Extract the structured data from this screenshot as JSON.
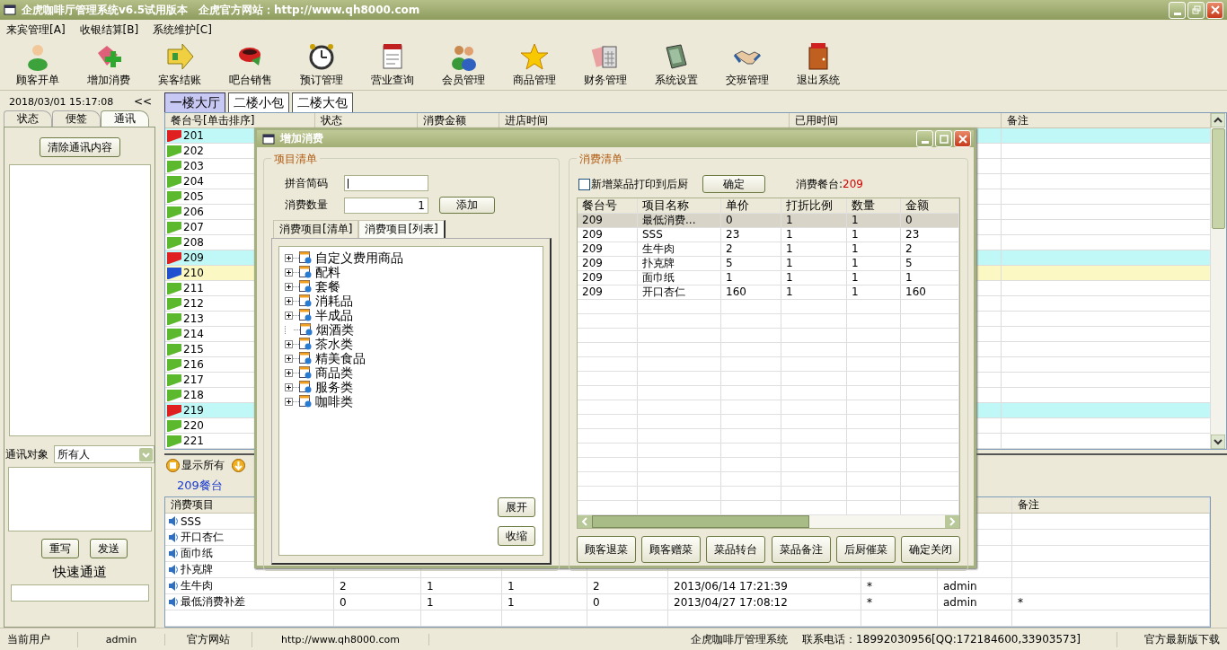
{
  "window": {
    "title": "企虎咖啡厅管理系统v6.5试用版本　企虎官方网站：http://www.qh8000.com"
  },
  "menu": [
    "来宾管理[A]",
    "收银结算[B]",
    "系统维护[C]"
  ],
  "toolbar": [
    "顾客开单",
    "增加消费",
    "宾客结账",
    "吧台销售",
    "预订管理",
    "营业查询",
    "会员管理",
    "商品管理",
    "财务管理",
    "系统设置",
    "交班管理",
    "退出系统"
  ],
  "left_panel": {
    "datetime": "2018/03/01 15:17:08",
    "collapse": "<<",
    "tabs": [
      {
        "label": "状态",
        "selected": false
      },
      {
        "label": "便签",
        "selected": false
      },
      {
        "label": "通讯",
        "selected": true
      }
    ],
    "clear_button": "清除通讯内容",
    "recipient_label": "通讯对象",
    "recipient": "所有人",
    "rewrite_button": "重写",
    "send_button": "发送",
    "quick_channel": "快速通道"
  },
  "floor_tabs": [
    {
      "label": "一楼大厅",
      "selected": true
    },
    {
      "label": "二楼小包",
      "selected": false
    },
    {
      "label": "二楼大包",
      "selected": false
    }
  ],
  "tables": {
    "columns": [
      "餐台号[单击排序]",
      "状态",
      "消费金额",
      "进店时间",
      "已用时间",
      "备注"
    ],
    "rows": [
      {
        "table": "201",
        "color": "#e02020",
        "occupied": true,
        "selected": false
      },
      {
        "table": "202",
        "color": "#5cb82c",
        "occupied": false,
        "selected": false
      },
      {
        "table": "203",
        "color": "#5cb82c",
        "occupied": false,
        "selected": false
      },
      {
        "table": "204",
        "color": "#5cb82c",
        "occupied": false,
        "selected": false
      },
      {
        "table": "205",
        "color": "#5cb82c",
        "occupied": false,
        "selected": false
      },
      {
        "table": "206",
        "color": "#5cb82c",
        "occupied": false,
        "selected": false
      },
      {
        "table": "207",
        "color": "#5cb82c",
        "occupied": false,
        "selected": false
      },
      {
        "table": "208",
        "color": "#5cb82c",
        "occupied": false,
        "selected": false
      },
      {
        "table": "209",
        "color": "#e02020",
        "occupied": true,
        "selected": false
      },
      {
        "table": "210",
        "color": "#2050d0",
        "occupied": false,
        "selected": true
      },
      {
        "table": "211",
        "color": "#5cb82c",
        "occupied": false,
        "selected": false
      },
      {
        "table": "212",
        "color": "#5cb82c",
        "occupied": false,
        "selected": false
      },
      {
        "table": "213",
        "color": "#5cb82c",
        "occupied": false,
        "selected": false
      },
      {
        "table": "214",
        "color": "#5cb82c",
        "occupied": false,
        "selected": false
      },
      {
        "table": "215",
        "color": "#5cb82c",
        "occupied": false,
        "selected": false
      },
      {
        "table": "216",
        "color": "#5cb82c",
        "occupied": false,
        "selected": false
      },
      {
        "table": "217",
        "color": "#5cb82c",
        "occupied": false,
        "selected": false
      },
      {
        "table": "218",
        "color": "#5cb82c",
        "occupied": false,
        "selected": false
      },
      {
        "table": "219",
        "color": "#e02020",
        "occupied": true,
        "selected": false
      },
      {
        "table": "220",
        "color": "#5cb82c",
        "occupied": false,
        "selected": false
      },
      {
        "table": "221",
        "color": "#5cb82c",
        "occupied": false,
        "selected": false
      }
    ]
  },
  "show_all_button": "显示所有",
  "detail_tab": "209餐台",
  "detail_table": {
    "columns": [
      "消费项目",
      "",
      "",
      "",
      "",
      "",
      "",
      "",
      "备注"
    ],
    "rows": [
      {
        "cells": [
          "SSS"
        ]
      },
      {
        "cells": [
          "开口杏仁"
        ]
      },
      {
        "cells": [
          "面巾纸"
        ]
      },
      {
        "cells": [
          "扑克牌"
        ]
      },
      {
        "cells": [
          "生牛肉",
          "2",
          "1",
          "1",
          "2",
          "2013/06/14 17:21:39",
          "*",
          "admin"
        ]
      },
      {
        "cells": [
          "最低消费补差",
          "0",
          "1",
          "1",
          "0",
          "2013/04/27 17:08:12",
          "*",
          "admin",
          "*"
        ]
      }
    ]
  },
  "status_bar": [
    "当前用户",
    "admin",
    "官方网站",
    "http://www.qh8000.com",
    "企虎咖啡厅管理系统",
    "联系电话：18992030956[QQ:172184600,33903573]",
    "官方最新版下载"
  ],
  "dialog": {
    "title": "增加消费",
    "left": {
      "title": "项目清单",
      "pinyin_label": "拼音简码",
      "quantity_label": "消费数量",
      "quantity": "1",
      "add_button": "添加",
      "tabs": [
        {
          "label": "消费项目[清单]",
          "selected": false
        },
        {
          "label": "消费项目[列表]",
          "selected": true
        }
      ],
      "tree": [
        {
          "label": "自定义费用商品",
          "expandable": true
        },
        {
          "label": "配料",
          "expandable": true
        },
        {
          "label": "套餐",
          "expandable": true
        },
        {
          "label": "消耗品",
          "expandable": true
        },
        {
          "label": "半成品",
          "expandable": true
        },
        {
          "label": "烟酒类",
          "expandable": false
        },
        {
          "label": "茶水类",
          "expandable": true
        },
        {
          "label": "精美食品",
          "expandable": true
        },
        {
          "label": "商品类",
          "expandable": true
        },
        {
          "label": "服务类",
          "expandable": true
        },
        {
          "label": "咖啡类",
          "expandable": true
        }
      ],
      "expand_button": "展开",
      "collapse_button": "收缩"
    },
    "right": {
      "title": "消费清单",
      "print_label": "新增菜品打印到后厨",
      "print_checked": false,
      "confirm_button": "确定",
      "table_label": "消费餐台:",
      "table_value": "209",
      "columns": [
        "餐台号",
        "项目名称",
        "单价",
        "打折比例",
        "数量",
        "金额"
      ],
      "rows": [
        {
          "cells": [
            "209",
            "最低消费...",
            "0",
            "1",
            "1",
            "0"
          ],
          "selected": true
        },
        {
          "cells": [
            "209",
            "SSS",
            "23",
            "1",
            "1",
            "23"
          ],
          "selected": false
        },
        {
          "cells": [
            "209",
            "生牛肉",
            "2",
            "1",
            "1",
            "2"
          ],
          "selected": false
        },
        {
          "cells": [
            "209",
            "扑克牌",
            "5",
            "1",
            "1",
            "5"
          ],
          "selected": false
        },
        {
          "cells": [
            "209",
            "面巾纸",
            "1",
            "1",
            "1",
            "1"
          ],
          "selected": false
        },
        {
          "cells": [
            "209",
            "开口杏仁",
            "160",
            "1",
            "1",
            "160"
          ],
          "selected": false
        }
      ],
      "buttons": [
        "顾客退菜",
        "顾客赠菜",
        "菜品转台",
        "菜品备注",
        "后厨催菜",
        "确定关闭"
      ]
    }
  }
}
